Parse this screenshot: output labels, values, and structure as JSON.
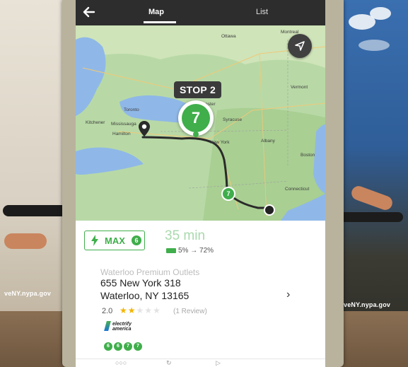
{
  "header": {
    "back_icon": "arrow-left-icon",
    "tabs": [
      {
        "label": "Map",
        "active": true
      },
      {
        "label": "List",
        "active": false
      }
    ]
  },
  "map": {
    "stop_label": "STOP 2",
    "stop_number": "7",
    "small_stop_number": "7",
    "compass_icon": "navigation-arrow-icon",
    "cities": [
      "Ottawa",
      "Montreal",
      "Toronto",
      "Mississauga",
      "Hamilton",
      "Kitchener",
      "Rochester",
      "Syracuse",
      "New York",
      "Albany",
      "Vermont",
      "Boston",
      "Connecticut"
    ]
  },
  "info": {
    "charge_mode": "MAX",
    "charge_badge": "6",
    "duration": "35 min",
    "charge_range": "5% → 72%",
    "place_name": "Waterloo Premium Outlets",
    "address_line1": "655 New York 318",
    "address_line2": "Waterloo, NY 13165",
    "rating_value": "2.0",
    "rating_stars": 2,
    "rating_max": 5,
    "reviews": "(1 Review)",
    "network_logo": "electrify america",
    "connectors": [
      "6",
      "6",
      "7",
      "7"
    ]
  },
  "wall": {
    "left_text": "veNY.nypa.gov",
    "right_text": "veNY.nypa.gov"
  },
  "colors": {
    "accent_green": "#3fae4b",
    "header_dark": "#2d2d2d",
    "star": "#f4b400"
  }
}
